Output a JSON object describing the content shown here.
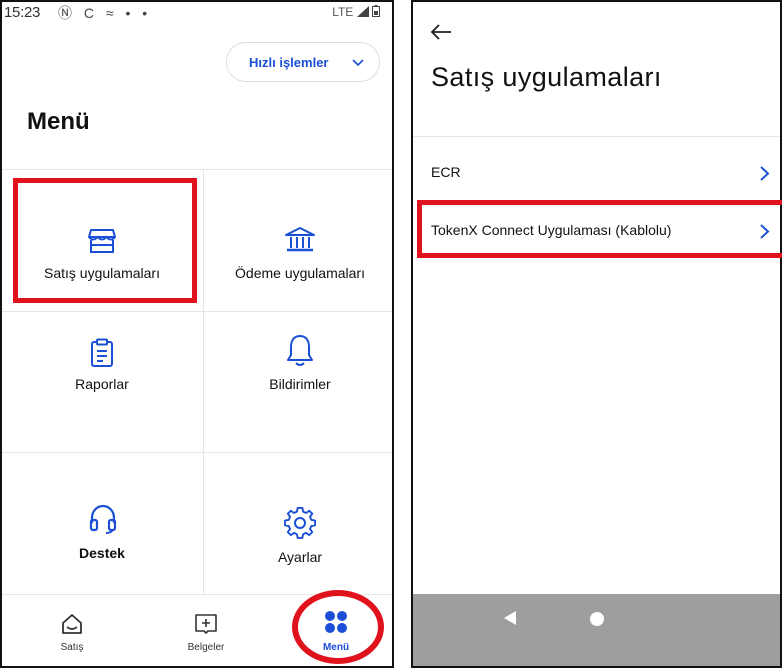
{
  "left_phone": {
    "status": {
      "time": "15:23",
      "icons": "Ⓝ C ≈ • •",
      "network": "LTE"
    },
    "quick_actions_label": "Hızlı işlemler",
    "title": "Menü",
    "tiles": [
      {
        "label": "Satış uygulamaları",
        "icon": "store-icon"
      },
      {
        "label": "Ödeme uygulamaları",
        "icon": "bank-icon"
      },
      {
        "label": "Raporlar",
        "icon": "clipboard-icon"
      },
      {
        "label": "Bildirimler",
        "icon": "bell-icon"
      },
      {
        "label": "Destek",
        "icon": "headset-icon"
      },
      {
        "label": "Ayarlar",
        "icon": "gear-icon"
      }
    ],
    "bottom_nav": [
      {
        "label": "Satış",
        "icon": "home-icon"
      },
      {
        "label": "Belgeler",
        "icon": "document-add-icon"
      },
      {
        "label": "Menü",
        "icon": "grid-icon",
        "active": true
      }
    ]
  },
  "right_phone": {
    "title": "Satış uygulamaları",
    "items": [
      {
        "label": "ECR"
      },
      {
        "label": "TokenX Connect Uygulaması (Kablolu)"
      }
    ]
  },
  "colors": {
    "accent": "#1a4fd6",
    "highlight": "#e0121b",
    "system_nav": "#9e9e9e"
  }
}
